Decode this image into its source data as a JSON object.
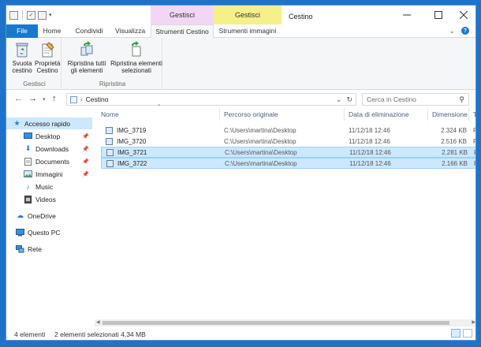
{
  "window": {
    "title": "Cestino",
    "context_tabs": [
      "Gestisci",
      "Gestisci"
    ]
  },
  "tabs": {
    "file": "File",
    "home": "Home",
    "share": "Condividi",
    "view": "Visualizza",
    "recycle_tools": "Strumenti Cestino",
    "image_tools": "Strumenti immagini"
  },
  "ribbon": {
    "empty_bin": "Svuota cestino",
    "bin_properties": "Proprietà Cestino",
    "group_manage": "Gestisci",
    "restore_all": "Ripristina tutti gli elementi",
    "restore_selected": "Ripristina elementi selezionati",
    "group_restore": "Ripristina"
  },
  "address": {
    "path": "Cestino",
    "search_placeholder": "Cerca in Cestino"
  },
  "nav": {
    "quick_access": "Accesso rapido",
    "desktop": "Desktop",
    "downloads": "Downloads",
    "documents": "Documents",
    "images": "Immagini",
    "music": "Music",
    "videos": "Videos",
    "onedrive": "OneDrive",
    "this_pc": "Questo PC",
    "network": "Rete"
  },
  "columns": {
    "name": "Nome",
    "original_path": "Percorso originale",
    "deleted_date": "Data di eliminazione",
    "size": "Dimensione",
    "type": "T"
  },
  "files": [
    {
      "name": "IMG_3719",
      "path": "C:\\Users\\martina\\Desktop",
      "date": "11/12/18 12:46",
      "size": "2.324 KB",
      "type": "F",
      "selected": false
    },
    {
      "name": "IMG_3720",
      "path": "C:\\Users\\martina\\Desktop",
      "date": "11/12/18 12:46",
      "size": "2.516 KB",
      "type": "F",
      "selected": false
    },
    {
      "name": "IMG_3721",
      "path": "C:\\Users\\martina\\Desktop",
      "date": "11/12/18 12:46",
      "size": "2.281 KB",
      "type": "F",
      "selected": true
    },
    {
      "name": "IMG_3722",
      "path": "C:\\Users\\martina\\Desktop",
      "date": "11/12/18 12:46",
      "size": "2.166 KB",
      "type": "F",
      "selected": true
    }
  ],
  "status": {
    "count": "4 elementi",
    "selection": "2 elementi selezionati  4,34 MB"
  },
  "colors": {
    "accent": "#1979ca",
    "selection": "#cce8ff",
    "context_pink": "#f3d6f6",
    "context_yellow": "#f6f08a"
  }
}
